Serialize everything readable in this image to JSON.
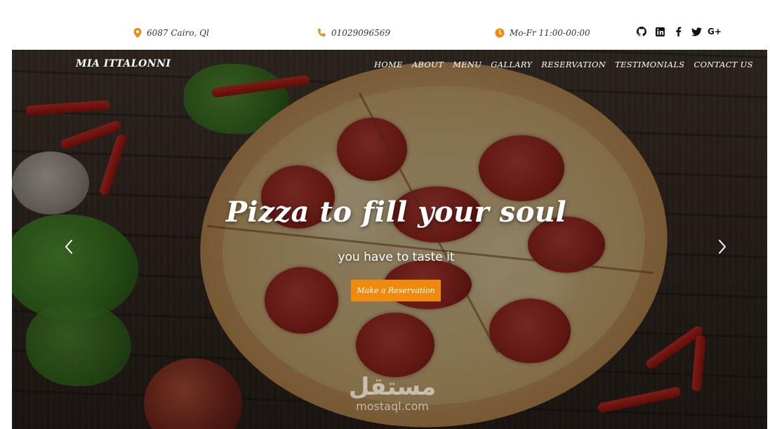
{
  "topbar": {
    "address": "6087 Cairo, Ql",
    "phone": "01029096569",
    "hours": "Mo-Fr 11:00-00:00",
    "socials": [
      {
        "icon": "github-icon"
      },
      {
        "icon": "linkedin-icon"
      },
      {
        "icon": "facebook-icon"
      },
      {
        "icon": "twitter-icon"
      },
      {
        "icon": "google-plus-icon",
        "label": "G+"
      }
    ],
    "accent_color": "#ef8a0e"
  },
  "navbar": {
    "brand": "MIA ITTALONNI",
    "items": [
      {
        "label": "HOME"
      },
      {
        "label": "ABOUT"
      },
      {
        "label": "MENU"
      },
      {
        "label": "GALLARY"
      },
      {
        "label": "RESERVATION"
      },
      {
        "label": "TESTIMONIALS"
      },
      {
        "label": "CONTACT US"
      }
    ]
  },
  "hero": {
    "title": "Pizza to fill your soul",
    "subtitle": "you have to taste it",
    "cta_label": "Make a Reservation",
    "cta_color": "#ef8a0e",
    "prev_icon": "chevron-left-icon",
    "next_icon": "chevron-right-icon"
  },
  "watermark": {
    "logo_text": "مستقل",
    "text": "mostaql.com"
  }
}
